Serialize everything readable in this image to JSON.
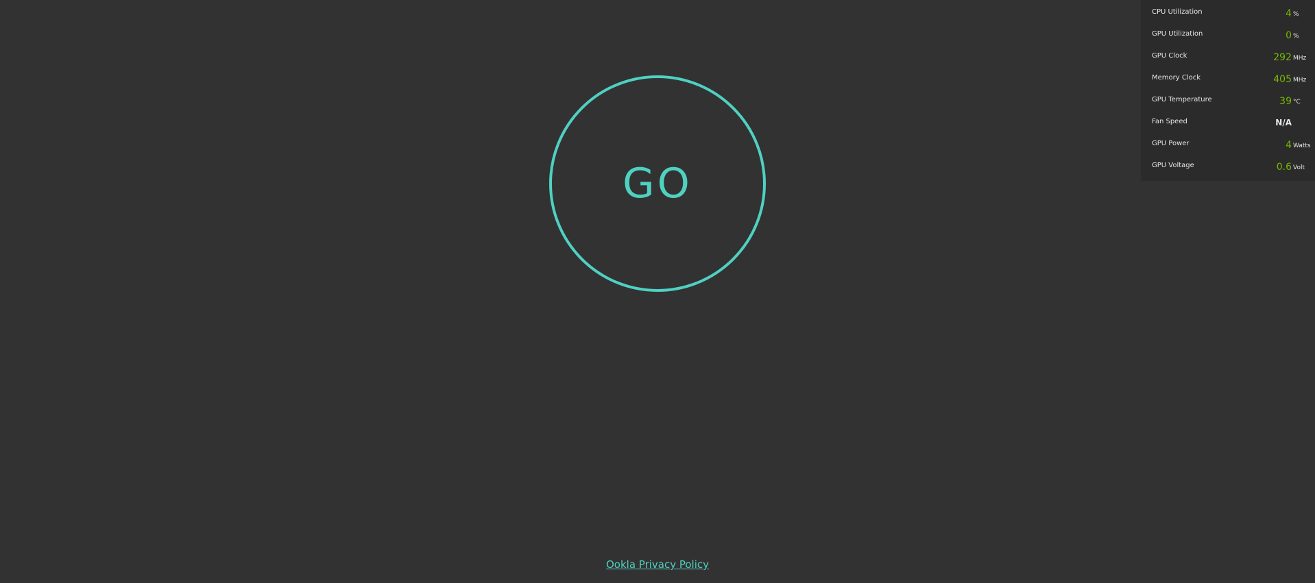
{
  "go_button": {
    "label": "GO"
  },
  "footer": {
    "privacy_link": "Ookla Privacy Policy"
  },
  "monitor": {
    "metrics": [
      {
        "label": "CPU Utilization",
        "value": "4",
        "unit": "%"
      },
      {
        "label": "GPU Utilization",
        "value": "0",
        "unit": "%"
      },
      {
        "label": "GPU Clock",
        "value": "292",
        "unit": "MHz"
      },
      {
        "label": "Memory Clock",
        "value": "405",
        "unit": "MHz"
      },
      {
        "label": "GPU Temperature",
        "value": "39",
        "unit": "°C"
      },
      {
        "label": "Fan Speed",
        "value": "N/A",
        "unit": ""
      },
      {
        "label": "GPU Power",
        "value": "4",
        "unit": "Watts"
      },
      {
        "label": "GPU Voltage",
        "value": "0.6",
        "unit": "Volt"
      }
    ]
  },
  "colors": {
    "background": "#323232",
    "accent": "#4fd1c2",
    "metric_value": "#76b900",
    "overlay_bg": "#2b2b2b"
  }
}
